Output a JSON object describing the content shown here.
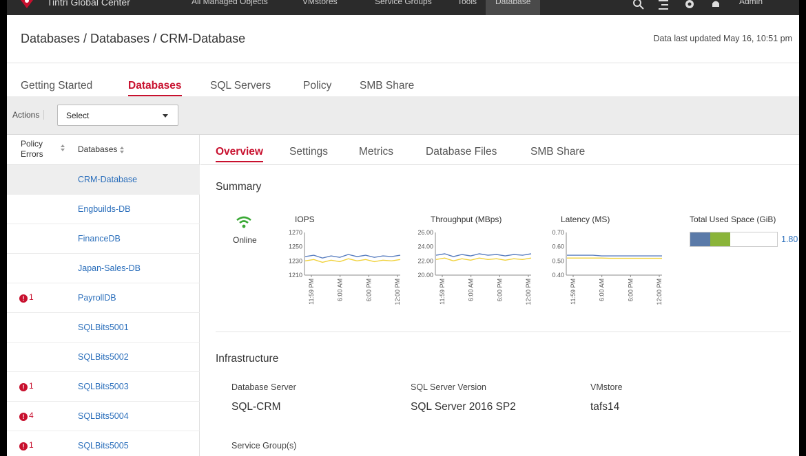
{
  "app": {
    "brand": "Tintri Global Center"
  },
  "topnav": {
    "items": [
      "All Managed Objects",
      "VMstores",
      "Service Groups",
      "Tools",
      "Database"
    ],
    "user": "Admin"
  },
  "header": {
    "breadcrumb": "Databases / Databases / CRM-Database",
    "updated": "Data last updated May 16, 10:51 pm"
  },
  "main_tabs": [
    "Getting Started",
    "Databases",
    "SQL Servers",
    "Policy",
    "SMB Share"
  ],
  "actions": {
    "label": "Actions",
    "select_value": "Select"
  },
  "db_list": {
    "headers": {
      "policy_errors": "Policy Errors",
      "databases": "Databases"
    },
    "rows": [
      {
        "name": "CRM-Database",
        "errors": ""
      },
      {
        "name": "Engbuilds-DB",
        "errors": ""
      },
      {
        "name": "FinanceDB",
        "errors": ""
      },
      {
        "name": "Japan-Sales-DB",
        "errors": ""
      },
      {
        "name": "PayrollDB",
        "errors": "1"
      },
      {
        "name": "SQLBits5001",
        "errors": ""
      },
      {
        "name": "SQLBits5002",
        "errors": ""
      },
      {
        "name": "SQLBits5003",
        "errors": "1"
      },
      {
        "name": "SQLBits5004",
        "errors": "4"
      },
      {
        "name": "SQLBits5005",
        "errors": "1"
      }
    ]
  },
  "sub_tabs": [
    "Overview",
    "Settings",
    "Metrics",
    "Database Files",
    "SMB Share"
  ],
  "summary": {
    "title": "Summary",
    "status": "Online",
    "total_used_space": {
      "label": "Total Used Space (GiB)",
      "value": "1.80"
    }
  },
  "chart_data": [
    {
      "type": "line",
      "title": "IOPS",
      "x": [
        "11:59 PM",
        "6:00 AM",
        "6:00 PM",
        "12:00 PM"
      ],
      "ylim": [
        1210,
        1270
      ],
      "yticks": [
        "1270",
        "1250",
        "1230",
        "1210"
      ],
      "series": [
        {
          "color": "#5a7fc0",
          "values": [
            1236,
            1238,
            1234,
            1237,
            1235,
            1239,
            1236,
            1238,
            1235,
            1237,
            1236,
            1238
          ]
        },
        {
          "color": "#f0d13a",
          "values": [
            1230,
            1232,
            1228,
            1231,
            1229,
            1233,
            1230,
            1232,
            1229,
            1231,
            1230,
            1232
          ]
        }
      ]
    },
    {
      "type": "line",
      "title": "Throughput (MBps)",
      "x": [
        "11:59 PM",
        "6:00 AM",
        "6:00 PM",
        "12:00 PM"
      ],
      "ylim": [
        20.0,
        26.0
      ],
      "yticks": [
        "26.00",
        "24.00",
        "22.00",
        "20.00"
      ],
      "series": [
        {
          "color": "#5a7fc0",
          "values": [
            22.8,
            23.0,
            22.6,
            22.9,
            22.7,
            23.0,
            22.8,
            22.9,
            22.7,
            22.9,
            22.8,
            23.0
          ]
        },
        {
          "color": "#f0d13a",
          "values": [
            22.2,
            22.4,
            22.0,
            22.3,
            22.1,
            22.4,
            22.2,
            22.3,
            22.1,
            22.3,
            22.2,
            22.4
          ]
        }
      ]
    },
    {
      "type": "line",
      "title": "Latency (MS)",
      "x": [
        "11:59 PM",
        "6:00 AM",
        "6:00 PM",
        "12:00 PM"
      ],
      "ylim": [
        0.4,
        0.7
      ],
      "yticks": [
        "0.70",
        "0.60",
        "0.50",
        "0.40"
      ],
      "series": [
        {
          "color": "#5a7fc0",
          "values": [
            0.54,
            0.54,
            0.54,
            0.54,
            0.535,
            0.535,
            0.535,
            0.535,
            0.535,
            0.535,
            0.535,
            0.535
          ]
        },
        {
          "color": "#f0d13a",
          "values": [
            0.52,
            0.52,
            0.52,
            0.52,
            0.52,
            0.518,
            0.518,
            0.518,
            0.518,
            0.518,
            0.518,
            0.518
          ]
        }
      ]
    }
  ],
  "infrastructure": {
    "title": "Infrastructure",
    "database_server": {
      "label": "Database Server",
      "value": "SQL-CRM"
    },
    "sql_version": {
      "label": "SQL Server Version",
      "value": "SQL Server 2016 SP2"
    },
    "vmstore": {
      "label": "VMstore",
      "value": "tafs14"
    },
    "service_groups": {
      "label": "Service Group(s)"
    }
  },
  "colors": {
    "accent": "#c8102e",
    "link": "#2a6ebb",
    "online": "#3aa935"
  }
}
